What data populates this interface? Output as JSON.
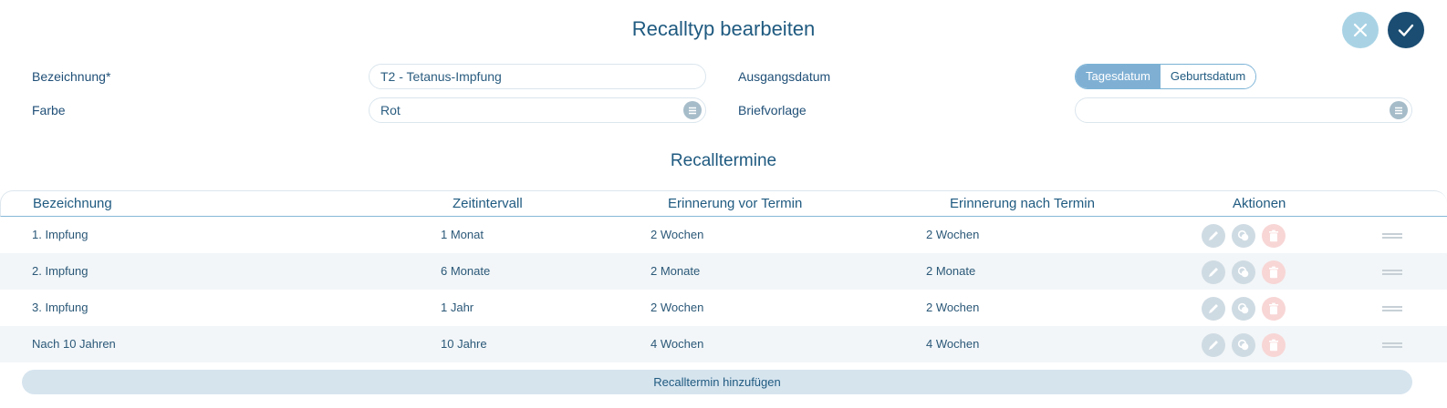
{
  "header": {
    "title": "Recalltyp bearbeiten",
    "cancel_icon": "close-icon",
    "confirm_icon": "checkmark-icon"
  },
  "form": {
    "bezeichnung_label": "Bezeichnung*",
    "bezeichnung_value": "T2 - Tetanus-Impfung",
    "farbe_label": "Farbe",
    "farbe_value": "Rot",
    "ausgangsdatum_label": "Ausgangsdatum",
    "ausgangsdatum_options": [
      "Tagesdatum",
      "Geburtsdatum"
    ],
    "ausgangsdatum_selected": "Tagesdatum",
    "briefvorlage_label": "Briefvorlage",
    "briefvorlage_value": ""
  },
  "recalltermine": {
    "title": "Recalltermine",
    "columns": [
      "Bezeichnung",
      "Zeitintervall",
      "Erinnerung vor Termin",
      "Erinnerung nach Termin",
      "Aktionen"
    ],
    "rows": [
      {
        "bezeichnung": "1. Impfung",
        "zeitintervall": "1 Monat",
        "vor": "2 Wochen",
        "nach": "2 Wochen"
      },
      {
        "bezeichnung": "2. Impfung",
        "zeitintervall": "6 Monate",
        "vor": "2 Monate",
        "nach": "2 Monate"
      },
      {
        "bezeichnung": "3. Impfung",
        "zeitintervall": "1 Jahr",
        "vor": "2 Wochen",
        "nach": "2 Wochen"
      },
      {
        "bezeichnung": "Nach 10 Jahren",
        "zeitintervall": "10 Jahre",
        "vor": "4 Wochen",
        "nach": "4 Wochen"
      }
    ],
    "add_label": "Recalltermin hinzufügen"
  },
  "colors": {
    "primary": "#1b4d72",
    "accent_light": "#a9d3e5",
    "segment_active": "#7fb0d4",
    "delete": "#f8d6d6"
  }
}
